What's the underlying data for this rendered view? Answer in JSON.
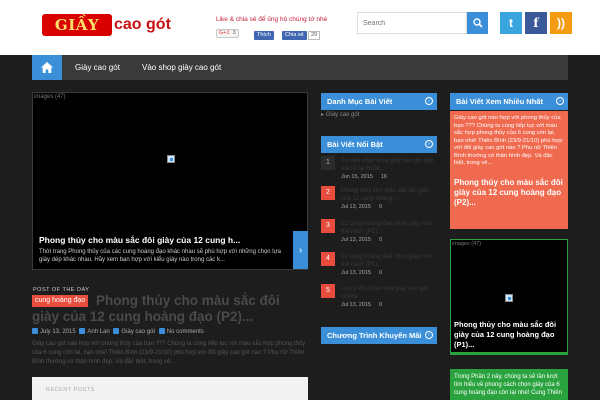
{
  "header": {
    "logo_box": "GIẦY",
    "logo_text": "cao gót",
    "share_text": "Like & chia sẻ để ủng hộ chúng tớ nhé",
    "gplus_label": "G+1",
    "gplus_count": "3",
    "fb_like": "Thích",
    "fb_share": "Chia sẻ",
    "fb_count": "29",
    "search_placeholder": "Search",
    "social_twitter": "t",
    "social_facebook": "f",
    "social_rss": "))"
  },
  "nav": {
    "items": [
      "Giày cao gót",
      "Vào shop giày cao gót"
    ]
  },
  "slider": {
    "img_alt": "images (47)",
    "title": "Phong thủy cho màu sắc đôi giày của 12 cung h...",
    "desc": "Thời trang Phong thủy của các cung hoàng đạo khác nhau sẽ phù hợp với những chọn lựa giày dép khác nhau. Hãy xem bạn hợp với kiểu giày nào trong các k..."
  },
  "post": {
    "label": "POST OF THE DAY",
    "category": "cung hoàng đạo",
    "title": "Phong thủy cho màu sắc đôi giày của 12 cung hoàng đạo (P2)...",
    "date": "July 13, 2015",
    "author": "Anh Lan",
    "cat": "Giày cao gót",
    "comments": "No comments",
    "excerpt": "Giày cao gót nào hợp với phong thủy của bạn ??? Chúng ta cùng tiếp tục với màu sắc hợp phong thủy của 6 cung còn lại, bạn nhé! Thiên Bình (23/9-21/10) phù hợp với đôi giày cao gót nào ? Phụ nữ Thiên Bình thường có thân hình đẹp. Và đặc biệt, trong vẻ..."
  },
  "recent": {
    "label": "RECENT POSTS"
  },
  "widgets": {
    "categories_title": "Danh Mục Bài Viết",
    "categories_item": "Giày cao gót",
    "featured_title": "Bài Viết Nổi Bật",
    "promo_title": "Chương Trình Khuyến Mãi",
    "popular_title": "Bài Viết Xem Nhiều Nhất"
  },
  "featured": [
    {
      "num": "1",
      "text": "Tư vấn chọn mua giày cao gót đẹp mà rẻ tại HCM...",
      "date": "Jun 15, 2015",
      "count": "16"
    },
    {
      "num": "2",
      "text": "Phong thủy cho màu sắc đôi giày của 12 cung hoàng ...",
      "date": "Jul 13, 2015",
      "count": "0"
    },
    {
      "num": "3",
      "text": "12 cung hoàng đạo chọn giày như thế nào? (P2)...",
      "date": "Jul 13, 2015",
      "count": "0"
    },
    {
      "num": "4",
      "text": "12 cung hoàng đạo chọn giày như thế nào? (P1)...",
      "date": "Jul 13, 2015",
      "count": "0"
    },
    {
      "num": "5",
      "text": "Lưu ý khi chọn mua giày cao gót Online",
      "date": "Jul 13, 2015",
      "count": "0"
    }
  ],
  "popular": {
    "red_desc": "Giày cao gót nào hợp với phong thủy của bạn ??? Chúng ta cùng tiếp tục với màu sắc hợp phong thủy của 6 cung còn lại, bạn nhé! Thiên Bình (23/9-21/10) phù hợp với đôi giày cao gót nào ? Phụ nữ Thiên Bình thường có thân hình đẹp. Và đặc biệt, trong vẻ...",
    "red_title": "Phong thủy cho màu sắc đôi giày của 12 cung hoàng đạo (P2)...",
    "green_img_alt": "images (47)",
    "green_title": "Phong thủy cho màu sắc đôi giày của 12 cung hoàng đạo (P1)...",
    "green2_desc": "Trong Phần 2 này, chúng ta sẽ lần lượt tìm hiểu về phong cách chọn giày của 6 cung hoàng đạo còn lại nhé! Cung Thiên"
  },
  "colors": {
    "accent": "#3a8fd8",
    "red": "#e74c3c",
    "green": "#2aa33e",
    "coral": "#ef6a4f"
  }
}
